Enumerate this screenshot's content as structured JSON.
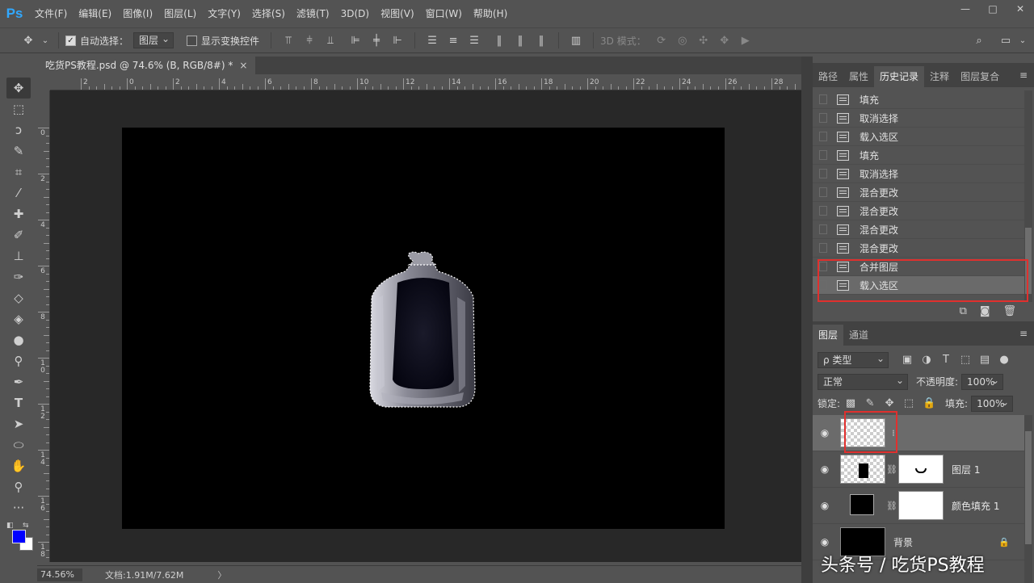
{
  "app": {
    "logo": "Ps"
  },
  "menu": [
    "文件(F)",
    "编辑(E)",
    "图像(I)",
    "图层(L)",
    "文字(Y)",
    "选择(S)",
    "滤镜(T)",
    "3D(D)",
    "视图(V)",
    "窗口(W)",
    "帮助(H)"
  ],
  "window_controls": {
    "minimize": "—",
    "restore": "□",
    "close": "✕"
  },
  "options": {
    "auto_select_label": "自动选择：",
    "auto_select_value": "图层",
    "show_transform_label": "显示变换控件",
    "mode_3d_label": "3D 模式："
  },
  "document": {
    "tab_title": "吃货PS教程.psd @ 74.6% (B, RGB/8#) *",
    "close": "×"
  },
  "ruler": {
    "h_labels": [
      "2",
      "0",
      "2",
      "4",
      "6",
      "8",
      "10",
      "12",
      "14",
      "16",
      "18",
      "20",
      "22",
      "24",
      "26",
      "28"
    ],
    "v_labels": [
      "0",
      "2",
      "4",
      "6",
      "8",
      "1\n0",
      "1\n2",
      "1\n4",
      "1\n6",
      "1\n8"
    ]
  },
  "status": {
    "zoom": "74.56%",
    "doc": "文档:1.91M/7.62M",
    "arrow": "〉"
  },
  "history_panel": {
    "tabs": [
      "路径",
      "属性",
      "历史记录",
      "注释",
      "图层复合"
    ],
    "active_tab": "历史记录",
    "items": [
      "填充",
      "取消选择",
      "载入选区",
      "填充",
      "取消选择",
      "混合更改",
      "混合更改",
      "混合更改",
      "混合更改",
      "合并图层",
      "载入选区"
    ],
    "selected_index": 10
  },
  "layers_panel": {
    "tabs": [
      "图层",
      "通道"
    ],
    "active_tab": "图层",
    "filter_label": "ρ 类型",
    "blend_mode": "正常",
    "opacity_label": "不透明度:",
    "opacity_value": "100%",
    "lock_label": "锁定:",
    "fill_label": "填充:",
    "fill_value": "100%",
    "layers": [
      {
        "name": "",
        "thumb": "checker",
        "mask": false,
        "selected": true
      },
      {
        "name": "图层 1",
        "thumb": "checker",
        "mask": true,
        "selected": false
      },
      {
        "name": "颜色填充 1",
        "thumb": "black",
        "mask": true,
        "selected": false
      },
      {
        "name": "背景",
        "thumb": "black",
        "mask": false,
        "selected": false,
        "locked": true
      }
    ]
  },
  "colors": {
    "foreground": "#0000ff",
    "background": "#ffffff",
    "accent": "#31a8ff",
    "highlight": "#e0302e"
  },
  "watermark": "头条号 / 吃货PS教程"
}
